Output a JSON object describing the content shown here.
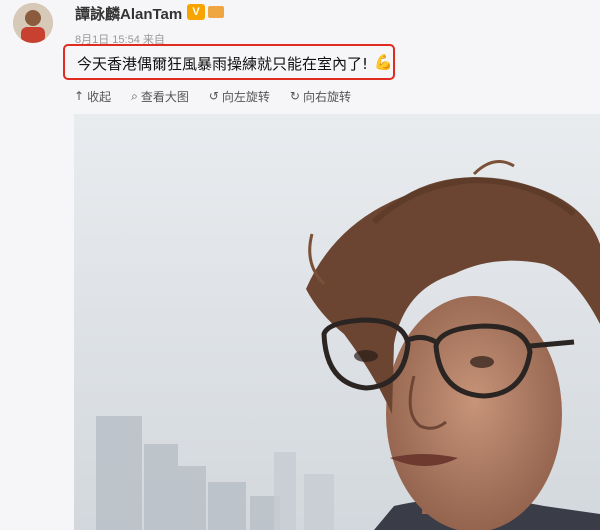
{
  "user": {
    "name": "譚詠麟AlanTam",
    "vip_badge": "V"
  },
  "meta": {
    "date": "8月1日 15:54",
    "source": "来自"
  },
  "post": {
    "text": "今天香港偶爾狂風暴雨操練就只能在室內了!",
    "emoji": "💪"
  },
  "actions": [
    {
      "icon": "↑",
      "label": "收起"
    },
    {
      "icon": "⌕",
      "label": "查看大图"
    },
    {
      "icon": "↺",
      "label": "向左旋转"
    },
    {
      "icon": "↻",
      "label": "向右旋转"
    }
  ],
  "colors": {
    "highlight_border": "#e02b20",
    "vip": "#f7a400"
  }
}
